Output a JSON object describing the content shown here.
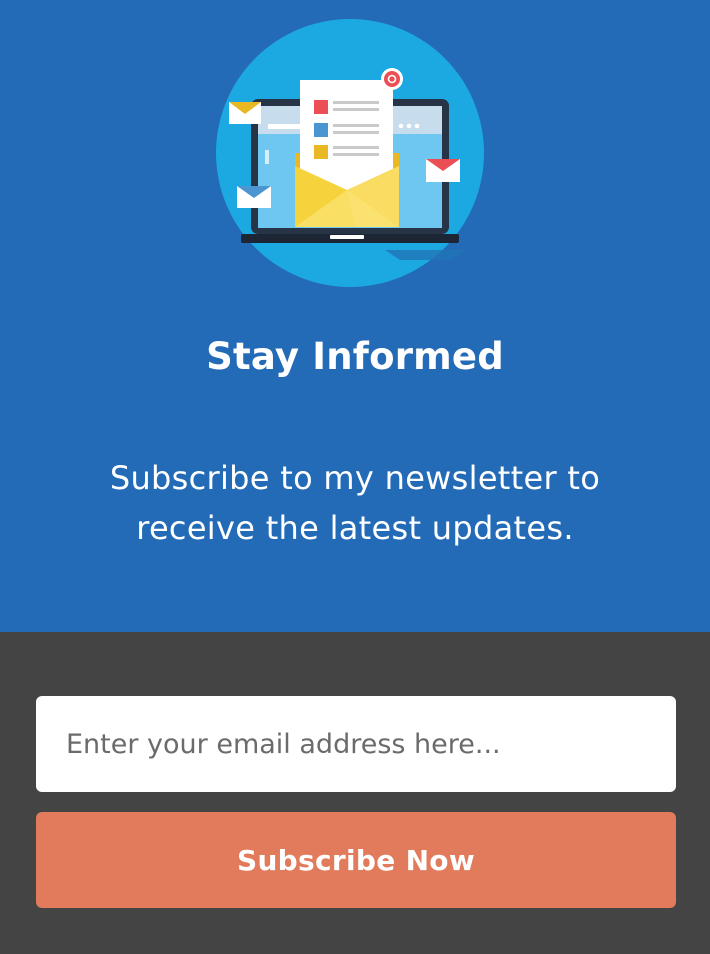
{
  "hero": {
    "illustration_icon": "newsletter-laptop-envelope-icon",
    "title": "Stay Informed",
    "subtitle_line1": "Subscribe to my newsletter to",
    "subtitle_line2": "receive the latest updates."
  },
  "form": {
    "email_value": "",
    "email_placeholder": "Enter your email address here...",
    "submit_label": "Subscribe Now"
  },
  "colors": {
    "hero_background": "#236bb7",
    "form_background": "#444444",
    "button_background": "#e27a5c",
    "illustration_circle": "#1ca9e1"
  }
}
